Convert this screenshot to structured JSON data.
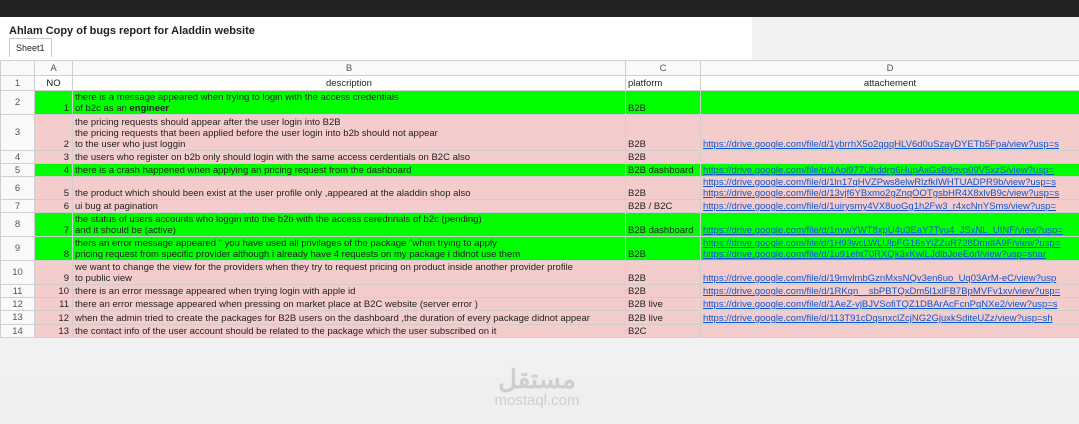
{
  "doc": {
    "title": "Ahlam Copy of bugs report for Aladdin website",
    "sheet_tab": "Sheet1"
  },
  "columns": [
    "A",
    "B",
    "C",
    "D"
  ],
  "headers": {
    "no": "NO",
    "description": "description",
    "platform": "platform",
    "attachment": "attachement"
  },
  "rows": [
    {
      "n": "2",
      "no": "1",
      "color": "green",
      "desc1": "there is a message appeared when trying to login with the access credentials",
      "desc2": "of b2c as an ",
      "bold": "engineer",
      "platform": "B2B",
      "link": ""
    },
    {
      "n": "3",
      "no": "2",
      "color": "pink",
      "desc1": "the pricing requests should appear after the user login into B2B",
      "desc2": "the pricing requests that been applied before the user login into b2b should not appear",
      "desc3": "to the user who just loggin",
      "platform": "B2B",
      "link": "https://drive.google.com/file/d/1ybrrhX5o2qqqHLV6d0uSzayDYETb5Fpa/view?usp=s"
    },
    {
      "n": "4",
      "no": "3",
      "color": "pink",
      "desc1": "the users who register on b2b only should login with the same access cerdentials on B2C also",
      "platform": "B2B",
      "link": ""
    },
    {
      "n": "5",
      "no": "4",
      "color": "green",
      "desc1": "there is a crash happened when applying an pricing request from the dashboard",
      "platform": "B2B dashboard",
      "link": "https://drive.google.com/file/d/1Aol977Uhddrg6HupAxGsB9gvp09V5xzS/view?usp="
    },
    {
      "n": "6",
      "no": "5",
      "color": "pink",
      "desc1": "the product which should been exist at the user profile only ,appeared at the aladdin shop also",
      "platform": "B2B",
      "link": "https://drive.google.com/file/d/1ln17qHVZPws8elwRlzfkIWHTUADPR9b/view?usp=s",
      "link2": "https://drive.google.com/file/d/13vjf6YBxmo2gZnqOOTgsbHR4X8xlvB9c/view?usp=s"
    },
    {
      "n": "7",
      "no": "6",
      "color": "pink",
      "desc1": "ui bug at pagination",
      "platform": "B2B / B2C",
      "link": "https://drive.google.com/file/d/1uirysmy4VX8uoGg1h2Fw3_r4xcNnYSms/view?usp="
    },
    {
      "n": "8",
      "no": "7",
      "color": "green",
      "desc1": "the status of users accounts who loggin into the b2b with the access cerednrials of b2c (pending)",
      "desc2": "and it should be (active)",
      "platform": "B2B dashboard",
      "link": "https://drive.google.com/file/d/1nvwYWT8xpU4u3EaY7Tyu4_JSxNL_UINF/view?usp="
    },
    {
      "n": "9",
      "no": "8",
      "color": "green",
      "desc1": "thers an error message appeared \" you have used all privilages of the package \"when trying to apply",
      "desc2": "pricing request from specific provider although i already have 4 requests on my package i didnot use them",
      "platform": "B2B",
      "link": "https://drive.google.com/file/d/1H93wcLWLUlpFG16sYiZZuR728DmdlA9F/view?usp=",
      "link2": "https://drive.google.com/file/d/1u91eht70RXQk3xKwlLJdlbJoeEorl/view?usp=shar"
    },
    {
      "n": "10",
      "no": "9",
      "color": "pink",
      "desc1": "we want to change the view for the providers when they try to request pricing on product inside another provider profile",
      "desc2": "to public view",
      "platform": "B2B",
      "link": "https://drive.google.com/file/d/19mvlmbGznMxsNQv3en6uo_Uq03ArM-eC/view?usp"
    },
    {
      "n": "11",
      "no": "10",
      "color": "pink",
      "desc1": "there is an error message appeared when trying login with apple id",
      "platform": "B2B",
      "link": "https://drive.google.com/file/d/1RKqn__sbPBTQxDm5l1xlFB7BpMVFv1xv/view?usp="
    },
    {
      "n": "12",
      "no": "11",
      "color": "pink",
      "desc1": "there an error message appeared when pressing on market place at B2C website (server error )",
      "platform": "B2B live",
      "link": "https://drive.google.com/file/d/1AeZ-vjBJVSofiTQZ1DBArAcFcnPqNXe2/view?usp=s"
    },
    {
      "n": "13",
      "no": "12",
      "color": "pink",
      "desc1": "when the admin tried to create the packages for B2B users on the dashboard ,the duration of every package didnot appear",
      "platform": "B2B live",
      "link": "https://drive.google.com/file/d/113T91cDqsnxclZcjNG2GjuxkSditeUZz/view?usp=sh"
    },
    {
      "n": "14",
      "no": "13",
      "color": "pink",
      "desc1": "the contact info of the user account should be related to the package which the user subscribed on it",
      "platform": "B2C",
      "link": ""
    }
  ],
  "watermark": {
    "arabic": "مستقل",
    "latin": "mostaql.com"
  },
  "colors": {
    "green": "#00ff00",
    "pink": "#f4cccc",
    "link": "#1155cc"
  }
}
